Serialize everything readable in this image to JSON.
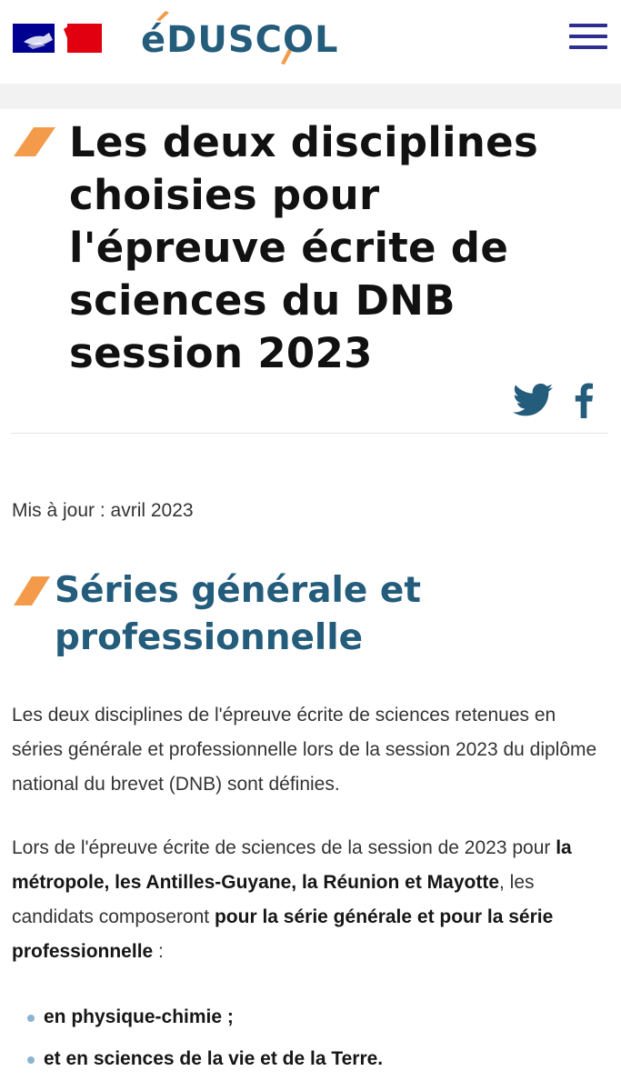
{
  "header": {
    "logo_text": "éDUSCOL",
    "menu_icon": "hamburger-menu-icon",
    "flag_colors": {
      "blue": "#000091",
      "red": "#e1000f"
    },
    "brand_color": "#245c7c",
    "accent_color": "#f39b4a"
  },
  "article": {
    "title": "Les deux disciplines choisies pour l'épreuve écrite de sciences du DNB session 2023",
    "share": {
      "twitter_icon": "twitter-icon",
      "facebook_icon": "facebook-icon"
    },
    "updated": "Mis à jour : avril 2023",
    "section_title": "Séries générale et professionnelle",
    "paragraph1": "Les deux disciplines de l'épreuve écrite de sciences retenues en séries générale et professionnelle lors de la session 2023 du diplôme national du brevet (DNB) sont définies.",
    "paragraph2": {
      "t1": "Lors de l'épreuve écrite de sciences de la session de 2023 pour ",
      "b1": "la métropole, les Antilles-Guyane, la Réunion et Mayotte",
      "t2": ", les candidats composeront ",
      "b2": "pour la série générale et pour la série professionnelle",
      "t3": " :"
    },
    "bullets": [
      "en physique-chimie ;",
      "et en sciences de la vie et de la Terre."
    ]
  }
}
